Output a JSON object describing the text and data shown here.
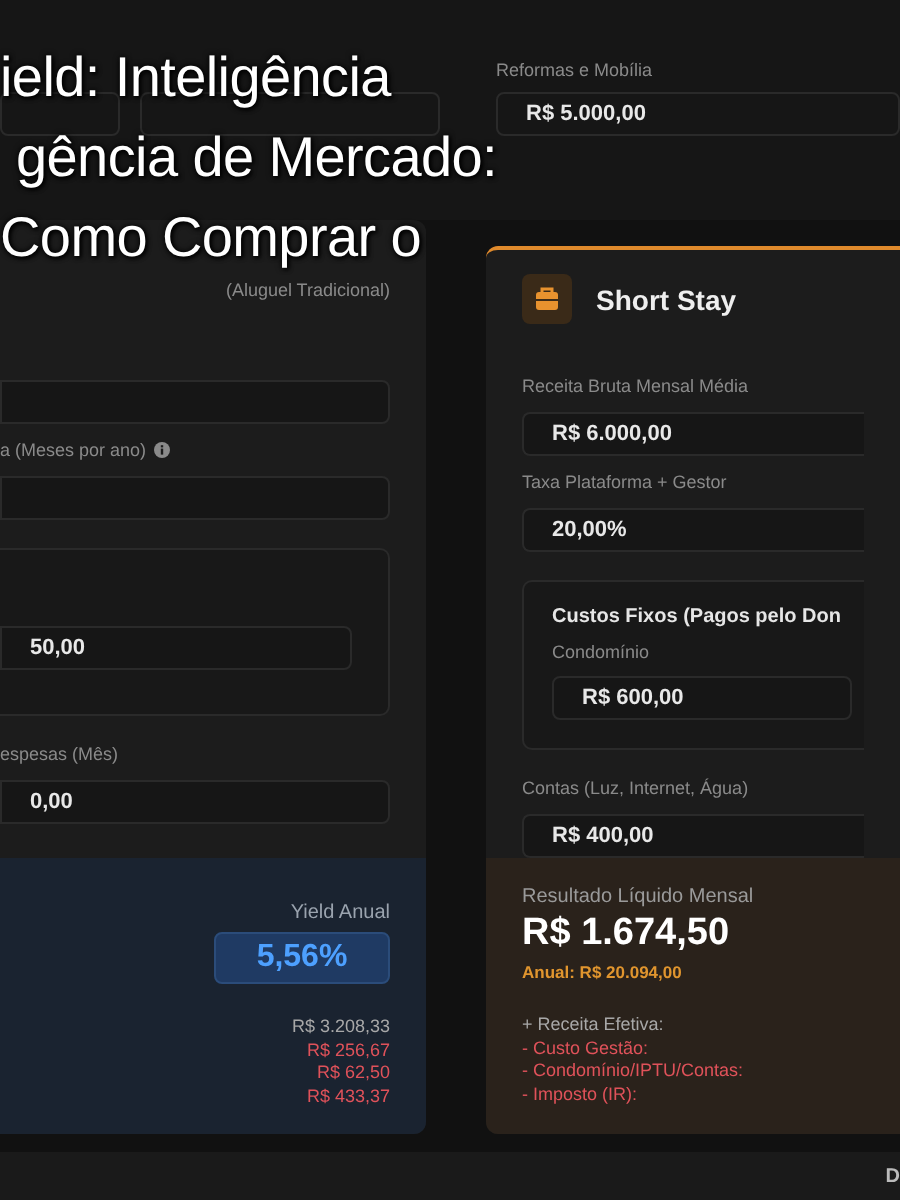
{
  "overlay_title": [
    "ield: Inteligência",
    "gência de Mercado:",
    "Como Comprar o"
  ],
  "top_row": {
    "fields": [
      {
        "kind": "field"
      },
      {
        "kind": "field"
      },
      {
        "kind": "labeled",
        "label": "Reformas e Mobília",
        "value": "R$ 5.000,00"
      }
    ]
  },
  "traditional": {
    "kind": "traditional",
    "subtitle": "(Aluguel Tradicional)",
    "items": [
      {
        "kind": "field"
      },
      {
        "kind": "label-info",
        "text": "a (Meses por ano)"
      },
      {
        "kind": "field"
      },
      {
        "kind": "group",
        "fields": [
          {
            "value": "50,00"
          }
        ]
      },
      {
        "kind": "label",
        "text": "espesas (Mês)"
      },
      {
        "kind": "field",
        "value": "0,00"
      }
    ],
    "result": {
      "label": "Yield Anual",
      "badge": "5,56%",
      "lines": [
        {
          "kind": "income",
          "text": "R$ 3.208,33"
        },
        {
          "kind": "expense",
          "text": "R$ 256,67"
        },
        {
          "kind": "expense",
          "text": "R$ 62,50"
        },
        {
          "kind": "expense",
          "text": "R$ 433,37"
        }
      ]
    }
  },
  "short_stay": {
    "kind": "short",
    "title": "Short Stay",
    "items": [
      {
        "kind": "label",
        "text": "Receita Bruta Mensal Média"
      },
      {
        "kind": "field",
        "value": "R$ 6.000,00"
      },
      {
        "kind": "label",
        "text": "Taxa Plataforma + Gestor"
      },
      {
        "kind": "field",
        "value": "20,00%"
      },
      {
        "kind": "group",
        "title": "Custos Fixos (Pagos pelo Don",
        "fields": [
          {
            "label": "Condomínio",
            "value": "R$ 600,00"
          }
        ]
      },
      {
        "kind": "label",
        "text": "Contas (Luz, Internet, Água)"
      },
      {
        "kind": "field",
        "value": "R$ 400,00"
      }
    ],
    "result": {
      "label": "Resultado Líquido Mensal",
      "value": "R$ 1.674,50",
      "annual": "Anual: R$ 20.094,00",
      "lines": [
        {
          "kind": "income",
          "text": "+ Receita Efetiva:"
        },
        {
          "kind": "expense",
          "text": "- Custo Gestão:"
        },
        {
          "kind": "expense",
          "text": "- Condomínio/IPTU/Contas:"
        },
        {
          "kind": "expense",
          "text": "- Imposto (IR):"
        }
      ]
    }
  },
  "status_bar": {
    "text": "D"
  }
}
